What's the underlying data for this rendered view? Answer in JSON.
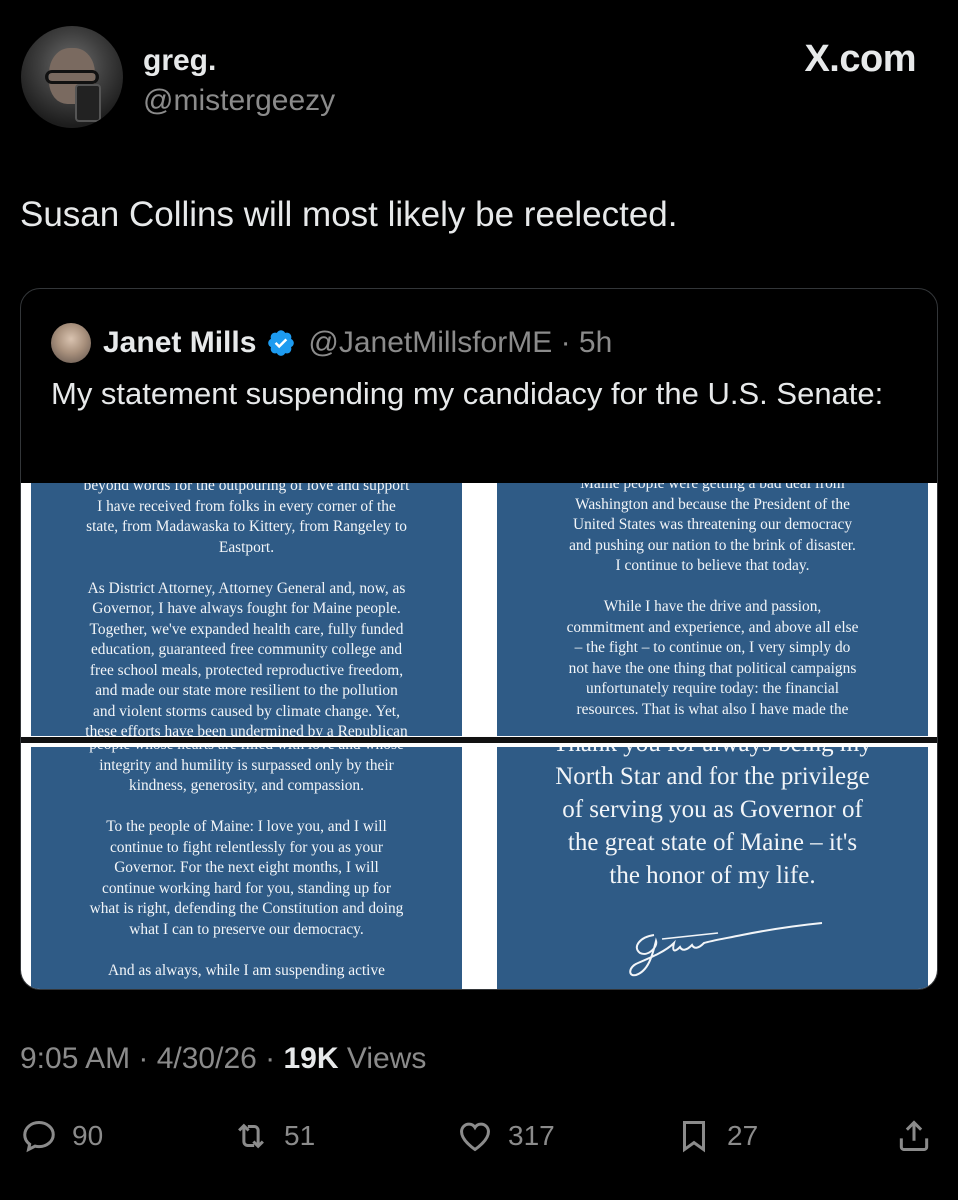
{
  "header": {
    "name": "greg.",
    "handle": "@mistergeezy",
    "logo_text": "X.com"
  },
  "tweet": {
    "text": "Susan Collins will most likely be reelected."
  },
  "quoted": {
    "name": "Janet Mills",
    "handle_time": "@JanetMillsforME · 5h",
    "text": "My statement suspending my candidacy for the U.S. Senate:",
    "panels": {
      "top_left": "beyond words for the outpouring of love and support\nI have received from folks in every corner of the\nstate, from Madawaska to Kittery, from Rangeley to\nEastport.\n\nAs District Attorney, Attorney General and, now, as\nGovernor, I have always fought for Maine people.\nTogether, we've expanded health care, fully funded\neducation, guaranteed free community college and\nfree school meals, protected reproductive freedom,\nand made our state more resilient to the pollution\nand violent storms caused by climate change. Yet,\nthese efforts have been undermined by a Republican",
      "top_right": "Maine people were getting a bad deal from\nWashington and because the President of the\nUnited States was threatening our democracy\nand pushing our nation to the brink of disaster.\nI continue to believe that today.\n\nWhile I have the drive and passion,\ncommitment and experience, and above all else\n– the fight – to continue on, I very simply do\nnot have the one thing that political campaigns\nunfortunately require today: the financial\nresources. That is what also I have made the",
      "bottom_left": "people whose hearts are filled with love and whose\nintegrity and humility is surpassed only by their\nkindness, generosity, and compassion.\n\nTo the people of Maine: I love you, and I will\ncontinue to fight relentlessly for you as your\nGovernor. For the next eight months, I will\ncontinue working hard for you, standing up for\nwhat is right, defending the Constitution and doing\nwhat I can to preserve our democracy.\n\nAnd as always, while I am suspending active",
      "bottom_right": "Thank you for always being my\nNorth Star and for the privilege\nof serving you as Governor of\nthe great state of Maine – it's\nthe honor of my life."
    }
  },
  "meta": {
    "time_date": "9:05 AM · 4/30/26 · ",
    "views_count": "19K",
    "views_label": " Views"
  },
  "actions": {
    "replies": "90",
    "reposts": "51",
    "likes": "317",
    "bookmarks": "27"
  },
  "colors": {
    "background": "#000000",
    "panel_blue": "#2f5b86",
    "verified_blue": "#1d9bf0",
    "muted_text": "#8b8b8b"
  }
}
